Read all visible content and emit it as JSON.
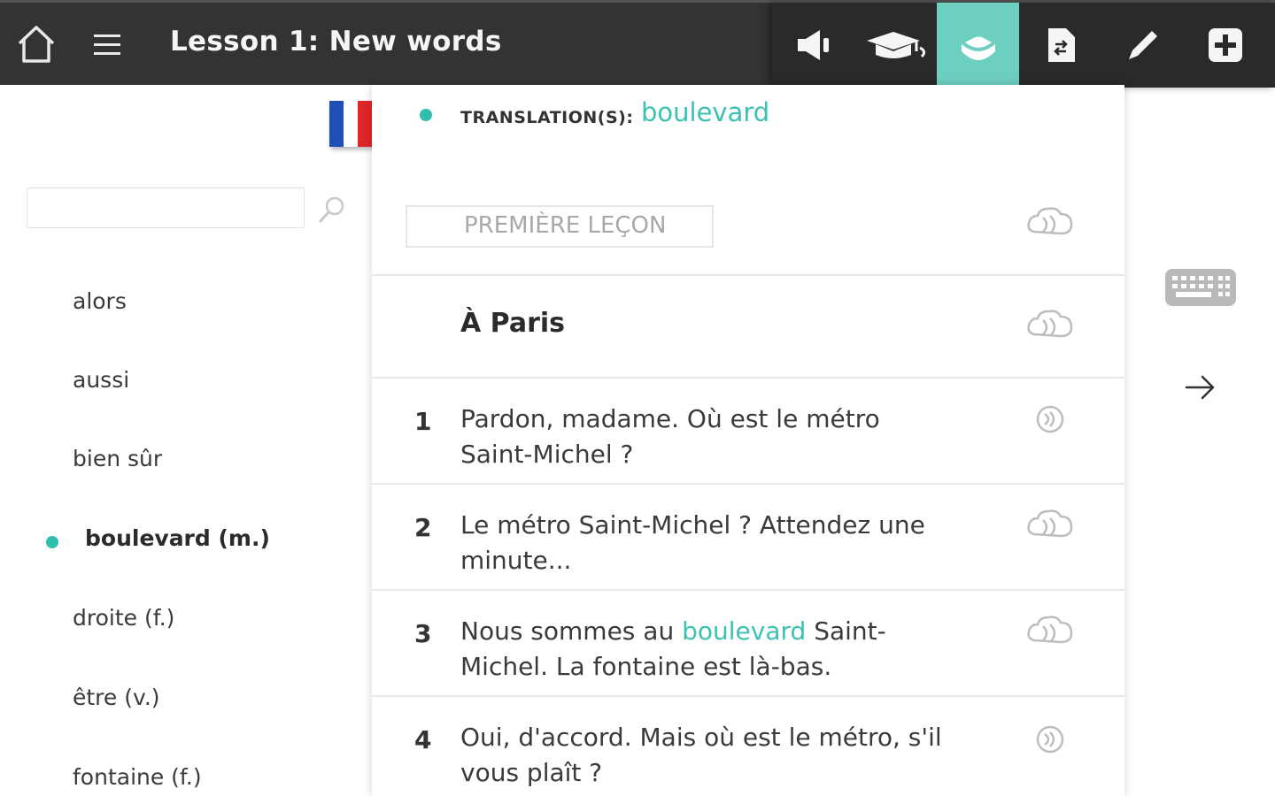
{
  "header": {
    "title": "Lesson 1: New words",
    "icons": [
      "home-icon",
      "menu-icon"
    ],
    "tools": [
      {
        "name": "speaker-icon",
        "active": false
      },
      {
        "name": "graduation-cap-icon",
        "active": false
      },
      {
        "name": "vocabulary-icon",
        "active": true
      },
      {
        "name": "document-icon",
        "active": false
      },
      {
        "name": "pencil-icon",
        "active": false
      },
      {
        "name": "add-icon",
        "active": false
      }
    ]
  },
  "colors": {
    "accent": "#3cc2b3",
    "active_tool": "#6dcfc0",
    "topbar": "#333333"
  },
  "sidebar": {
    "flag": "french-flag-icon",
    "search": {
      "value": "",
      "placeholder": ""
    },
    "words": [
      {
        "label": "alors",
        "selected": false
      },
      {
        "label": "aussi",
        "selected": false
      },
      {
        "label": "bien sûr",
        "selected": false
      },
      {
        "label": "boulevard (m.)",
        "selected": true
      },
      {
        "label": "droite (f.)",
        "selected": false
      },
      {
        "label": "être (v.)",
        "selected": false
      },
      {
        "label": "fontaine (f.)",
        "selected": false
      }
    ]
  },
  "panel": {
    "translation_label": "TRANSLATION(S):",
    "translation_value": "boulevard",
    "lesson_label": "PREMIÈRE LEÇON",
    "heading": "À Paris",
    "sentences": [
      {
        "num": "1",
        "before": "Pardon, madame. Où est le métro Saint-Michel ?",
        "highlight": "",
        "after": ""
      },
      {
        "num": "2",
        "before": "Le métro Saint-Michel ? Attendez une minute...",
        "highlight": "",
        "after": ""
      },
      {
        "num": "3",
        "before": "Nous sommes au ",
        "highlight": "boulevard",
        "after": " Saint-Michel. La fontaine est là-bas."
      },
      {
        "num": "4",
        "before": "Oui, d'accord. Mais où est le métro, s'il vous plaît ?",
        "highlight": "",
        "after": ""
      }
    ]
  },
  "right": {
    "icons": [
      "keyboard-icon",
      "arrow-right-icon"
    ]
  }
}
